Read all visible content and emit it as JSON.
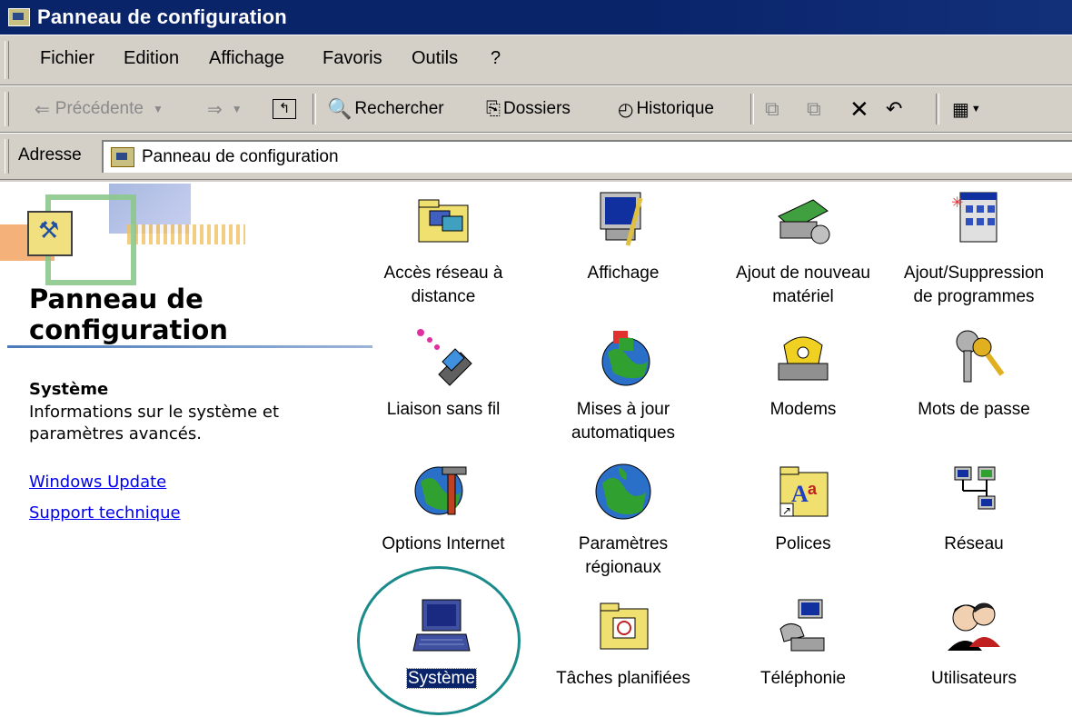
{
  "window": {
    "title": "Panneau de configuration"
  },
  "menubar": {
    "items": [
      {
        "label": "Fichier"
      },
      {
        "label": "Edition"
      },
      {
        "label": "Affichage"
      },
      {
        "label": "Favoris"
      },
      {
        "label": "Outils"
      },
      {
        "label": "?"
      }
    ]
  },
  "toolbar": {
    "back": "Précédente",
    "search": "Rechercher",
    "folders": "Dossiers",
    "history": "Historique"
  },
  "address": {
    "label": "Adresse",
    "value": "Panneau de configuration"
  },
  "left_panel": {
    "title_line1": "Panneau de",
    "title_line2": "configuration",
    "selected_title": "Système",
    "selected_desc": "Informations sur le système et paramètres avancés.",
    "links": [
      "Windows Update",
      "Support technique"
    ]
  },
  "items": [
    {
      "label1": "Accès réseau à",
      "label2": "distance",
      "icon": "network-folder-icon"
    },
    {
      "label1": "Affichage",
      "label2": "",
      "icon": "display-icon"
    },
    {
      "label1": "Ajout de nouveau",
      "label2": "matériel",
      "icon": "hardware-icon"
    },
    {
      "label1": "Ajout/Suppression",
      "label2": "de programmes",
      "icon": "programs-icon"
    },
    {
      "label1": "Liaison sans fil",
      "label2": "",
      "icon": "wireless-icon"
    },
    {
      "label1": "Mises à jour",
      "label2": "automatiques",
      "icon": "globe-update-icon"
    },
    {
      "label1": "Modems",
      "label2": "",
      "icon": "modem-phone-icon"
    },
    {
      "label1": "Mots de passe",
      "label2": "",
      "icon": "keys-icon"
    },
    {
      "label1": "Options Internet",
      "label2": "",
      "icon": "globe-tools-icon"
    },
    {
      "label1": "Paramètres",
      "label2": "régionaux",
      "icon": "globe-icon"
    },
    {
      "label1": "Polices",
      "label2": "",
      "icon": "fonts-folder-icon"
    },
    {
      "label1": "Réseau",
      "label2": "",
      "icon": "network-icon"
    },
    {
      "label1": "Système",
      "label2": "",
      "icon": "computer-icon"
    },
    {
      "label1": "Tâches planifiées",
      "label2": "",
      "icon": "scheduled-tasks-icon"
    },
    {
      "label1": "Téléphonie",
      "label2": "",
      "icon": "telephony-icon"
    },
    {
      "label1": "Utilisateurs",
      "label2": "",
      "icon": "users-icon"
    }
  ],
  "colors": {
    "title_bar": "#0a246a",
    "chrome": "#d4d0c8",
    "selection": "#0a246a",
    "link": "#0000ee",
    "highlight_circle": "#1a8a8a"
  }
}
